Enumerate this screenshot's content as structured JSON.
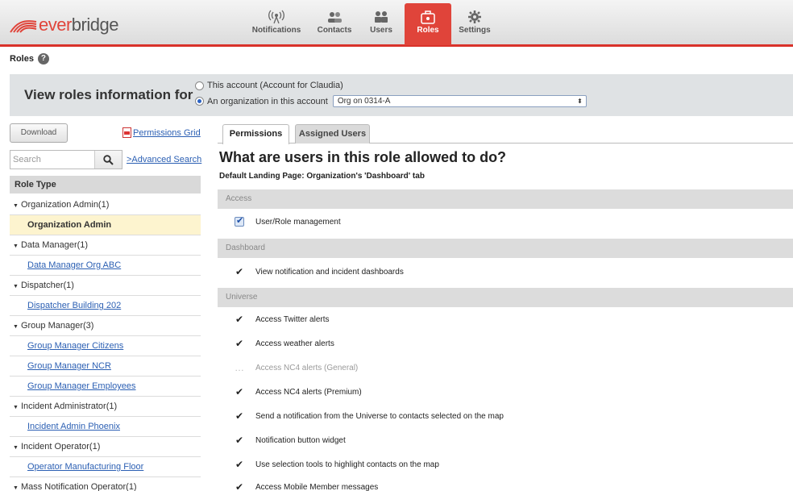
{
  "header": {
    "logo": {
      "ever": "ever",
      "bridge": "bridge"
    },
    "nav": [
      {
        "label": "Notifications",
        "icon": "broadcast-icon",
        "active": false
      },
      {
        "label": "Contacts",
        "icon": "contacts-icon",
        "active": false
      },
      {
        "label": "Users",
        "icon": "users-icon",
        "active": false
      },
      {
        "label": "Roles",
        "icon": "roles-icon",
        "active": true
      },
      {
        "label": "Settings",
        "icon": "gear-icon",
        "active": false
      }
    ]
  },
  "page": {
    "title": "Roles",
    "help": "?"
  },
  "filter": {
    "title": "View roles information for",
    "option_account": "This account (Account for Claudia)",
    "option_org": "An organization in this account",
    "org_selected": "Org on 0314-A"
  },
  "sidebar": {
    "download_label": "Download",
    "permissions_grid_label": "Permissions Grid",
    "search_placeholder": "Search",
    "advanced_search_label": ">Advanced Search",
    "role_type_header": "Role Type",
    "roles": [
      {
        "kind": "group",
        "label": "Organization Admin(1)"
      },
      {
        "kind": "item",
        "label": "Organization Admin",
        "selected": true
      },
      {
        "kind": "group",
        "label": "Data Manager(1)"
      },
      {
        "kind": "item",
        "label": "Data Manager Org ABC"
      },
      {
        "kind": "group",
        "label": "Dispatcher(1)"
      },
      {
        "kind": "item",
        "label": "Dispatcher Building 202"
      },
      {
        "kind": "group",
        "label": "Group Manager(3)"
      },
      {
        "kind": "item",
        "label": "Group Manager Citizens"
      },
      {
        "kind": "item",
        "label": "Group Manager NCR"
      },
      {
        "kind": "item",
        "label": "Group Manager Employees"
      },
      {
        "kind": "group",
        "label": "Incident Administrator(1)"
      },
      {
        "kind": "item",
        "label": "Incident Admin Phoenix"
      },
      {
        "kind": "group",
        "label": "Incident Operator(1)"
      },
      {
        "kind": "item",
        "label": "Operator Manufacturing Floor"
      },
      {
        "kind": "group",
        "label": "Mass Notification Operator(1)"
      }
    ]
  },
  "main": {
    "tabs": [
      {
        "label": "Permissions",
        "active": true
      },
      {
        "label": "Assigned Users",
        "active": false
      }
    ],
    "title": "What are users in this role allowed to do?",
    "landing": "Default Landing Page: Organization's 'Dashboard' tab",
    "sections": [
      {
        "name": "Access",
        "perms": [
          {
            "label": "User/Role management",
            "state": "checkbox"
          }
        ]
      },
      {
        "name": "Dashboard",
        "perms": [
          {
            "label": "View notification and incident dashboards",
            "state": "check"
          }
        ]
      },
      {
        "name": "Universe",
        "perms": [
          {
            "label": "Access Twitter alerts",
            "state": "check"
          },
          {
            "label": "Access weather alerts",
            "state": "check"
          },
          {
            "label": "Access NC4 alerts (General)",
            "state": "disabled"
          },
          {
            "label": "Access NC4 alerts (Premium)",
            "state": "check"
          },
          {
            "label": "Send a notification from the Universe to contacts selected on the map",
            "state": "check"
          },
          {
            "label": "Notification button widget",
            "state": "check"
          },
          {
            "label": "Use selection tools to highlight contacts on the map",
            "state": "check"
          },
          {
            "label": "Access Mobile Member messages",
            "state": "check"
          }
        ]
      }
    ]
  }
}
